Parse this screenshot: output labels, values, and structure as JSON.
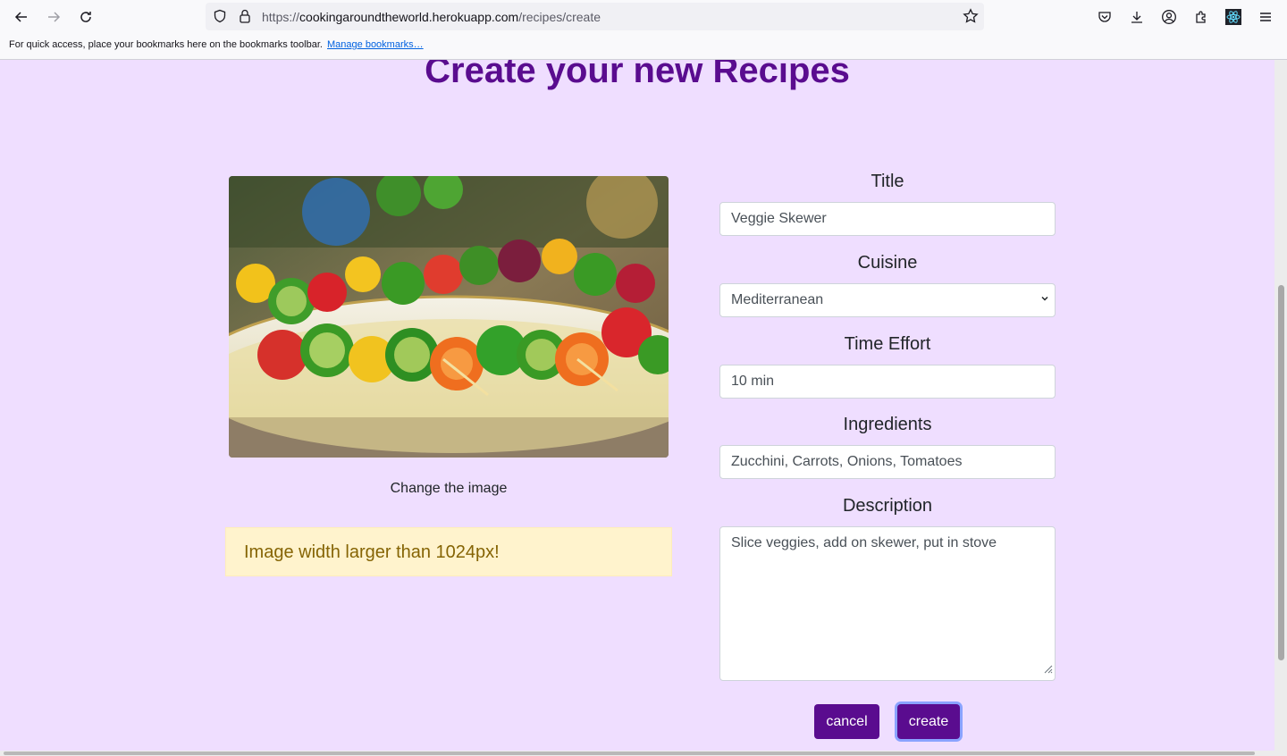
{
  "browser": {
    "url_scheme": "https://",
    "url_host": "cookingaroundtheworld.herokuapp.com",
    "url_path": "/recipes/create",
    "bookmarks_message": "For quick access, place your bookmarks here on the bookmarks toolbar.",
    "manage_bookmarks": "Manage bookmarks…"
  },
  "page": {
    "title": "Create your new Recipes",
    "image_alt": "Veggie skewers on a plate",
    "change_image": "Change the image",
    "alert": "Image width larger than 1024px!"
  },
  "form": {
    "title_label": "Title",
    "title_value": "Veggie Skewer",
    "cuisine_label": "Cuisine",
    "cuisine_value": "Mediterranean",
    "time_label": "Time Effort",
    "time_value": "10 min",
    "ingredients_label": "Ingredients",
    "ingredients_value": "Zucchini, Carrots, Onions, Tomatoes",
    "description_label": "Description",
    "description_value": "Slice veggies, add on skewer, put in stove",
    "cancel_label": "cancel",
    "create_label": "create"
  },
  "colors": {
    "page_bg": "#efdeff",
    "brand": "#5a0c8f",
    "alert_bg": "#fff3cd",
    "alert_text": "#856404"
  }
}
